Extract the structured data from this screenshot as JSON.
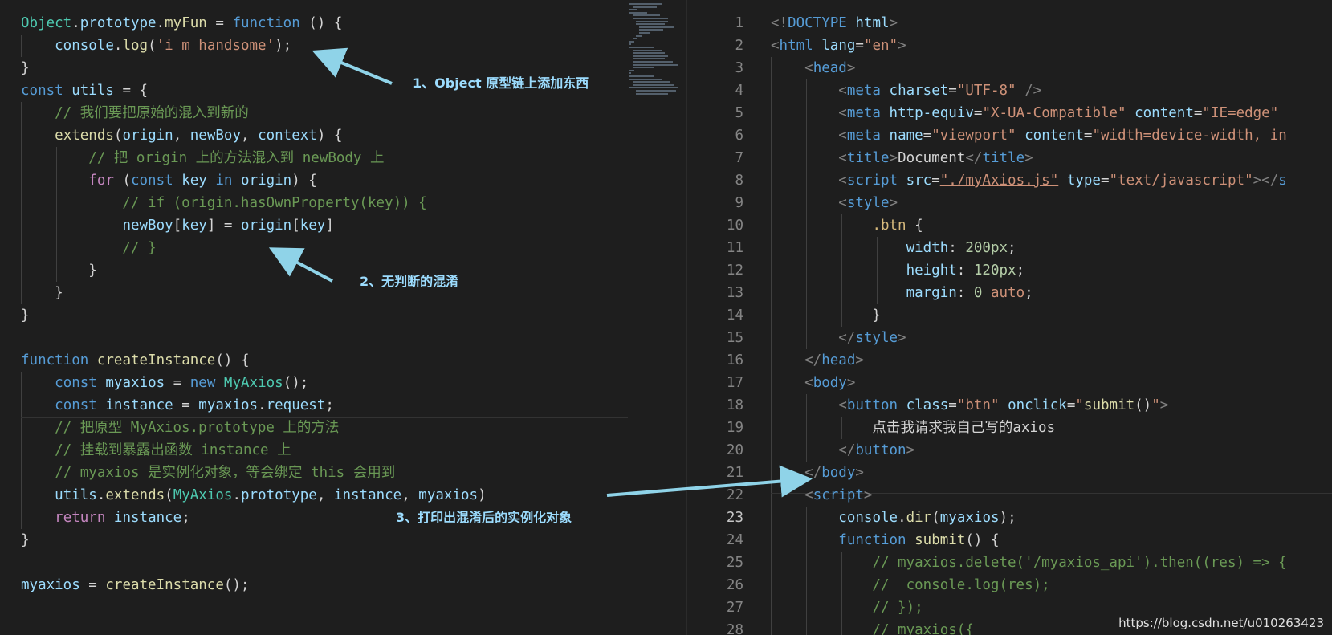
{
  "left_code": [
    [
      [
        "Object",
        "cls"
      ],
      [
        ".",
        "pun"
      ],
      [
        "prototype",
        "prop"
      ],
      [
        ".",
        "pun"
      ],
      [
        "myFun",
        "fn"
      ],
      [
        " = ",
        "pun"
      ],
      [
        "function",
        "kw"
      ],
      [
        " () {",
        "pun"
      ]
    ],
    [
      [
        "    console",
        "var"
      ],
      [
        ".",
        "pun"
      ],
      [
        "log",
        "fn"
      ],
      [
        "(",
        "pun"
      ],
      [
        "'i m handsome'",
        "str"
      ],
      [
        ");",
        "pun"
      ]
    ],
    [
      [
        "}",
        "pun"
      ]
    ],
    [
      [
        "const",
        "kw"
      ],
      [
        " ",
        "pun"
      ],
      [
        "utils",
        "var"
      ],
      [
        " = {",
        "pun"
      ]
    ],
    [
      [
        "    // 我们要把原始的混入到新的",
        "com"
      ]
    ],
    [
      [
        "    ",
        "pun"
      ],
      [
        "extends",
        "fn"
      ],
      [
        "(",
        "pun"
      ],
      [
        "origin",
        "var"
      ],
      [
        ", ",
        "pun"
      ],
      [
        "newBoy",
        "var"
      ],
      [
        ", ",
        "pun"
      ],
      [
        "context",
        "var"
      ],
      [
        ") {",
        "pun"
      ]
    ],
    [
      [
        "        // 把 origin 上的方法混入到 newBody 上",
        "com"
      ]
    ],
    [
      [
        "        ",
        "pun"
      ],
      [
        "for",
        "ctrl"
      ],
      [
        " (",
        "pun"
      ],
      [
        "const",
        "kw"
      ],
      [
        " ",
        "pun"
      ],
      [
        "key",
        "var"
      ],
      [
        " ",
        "pun"
      ],
      [
        "in",
        "kw"
      ],
      [
        " ",
        "pun"
      ],
      [
        "origin",
        "var"
      ],
      [
        ") {",
        "pun"
      ]
    ],
    [
      [
        "            // if (origin.hasOwnProperty(key)) {",
        "com"
      ]
    ],
    [
      [
        "            ",
        "pun"
      ],
      [
        "newBoy",
        "var"
      ],
      [
        "[",
        "pun"
      ],
      [
        "key",
        "var"
      ],
      [
        "] = ",
        "pun"
      ],
      [
        "origin",
        "var"
      ],
      [
        "[",
        "pun"
      ],
      [
        "key",
        "var"
      ],
      [
        "]",
        "pun"
      ]
    ],
    [
      [
        "            // }",
        "com"
      ]
    ],
    [
      [
        "        }",
        "pun"
      ]
    ],
    [
      [
        "    }",
        "pun"
      ]
    ],
    [
      [
        "}",
        "pun"
      ]
    ],
    [
      [
        "",
        "pun"
      ]
    ],
    [
      [
        "function",
        "kw"
      ],
      [
        " ",
        "pun"
      ],
      [
        "createInstance",
        "fn"
      ],
      [
        "() {",
        "pun"
      ]
    ],
    [
      [
        "    ",
        "pun"
      ],
      [
        "const",
        "kw"
      ],
      [
        " ",
        "pun"
      ],
      [
        "myaxios",
        "var"
      ],
      [
        " = ",
        "pun"
      ],
      [
        "new",
        "kw"
      ],
      [
        " ",
        "pun"
      ],
      [
        "MyAxios",
        "cls"
      ],
      [
        "();",
        "pun"
      ]
    ],
    [
      [
        "    ",
        "pun"
      ],
      [
        "const",
        "kw"
      ],
      [
        " ",
        "pun"
      ],
      [
        "instance",
        "var"
      ],
      [
        " = ",
        "pun"
      ],
      [
        "myaxios",
        "var"
      ],
      [
        ".",
        "pun"
      ],
      [
        "request",
        "prop"
      ],
      [
        ";",
        "pun"
      ]
    ],
    [
      [
        "    // 把原型 MyAxios.prototype 上的方法",
        "com"
      ]
    ],
    [
      [
        "    // 挂载到暴露出函数 instance 上",
        "com"
      ]
    ],
    [
      [
        "    // myaxios 是实例化对象，等会绑定 this 会用到",
        "com"
      ]
    ],
    [
      [
        "    ",
        "pun"
      ],
      [
        "utils",
        "var"
      ],
      [
        ".",
        "pun"
      ],
      [
        "extends",
        "fn"
      ],
      [
        "(",
        "pun"
      ],
      [
        "MyAxios",
        "cls"
      ],
      [
        ".",
        "pun"
      ],
      [
        "prototype",
        "prop"
      ],
      [
        ", ",
        "pun"
      ],
      [
        "instance",
        "var"
      ],
      [
        ", ",
        "pun"
      ],
      [
        "myaxios",
        "var"
      ],
      [
        ")",
        "pun"
      ]
    ],
    [
      [
        "    ",
        "pun"
      ],
      [
        "return",
        "ctrl"
      ],
      [
        " ",
        "pun"
      ],
      [
        "instance",
        "var"
      ],
      [
        ";",
        "pun"
      ]
    ],
    [
      [
        "}",
        "pun"
      ]
    ],
    [
      [
        "",
        "pun"
      ]
    ],
    [
      [
        "myaxios",
        "var"
      ],
      [
        " = ",
        "pun"
      ],
      [
        "createInstance",
        "fn"
      ],
      [
        "();",
        "pun"
      ]
    ]
  ],
  "right_code": [
    [
      [
        "<!",
        "brk"
      ],
      [
        "DOCTYPE",
        "tag"
      ],
      [
        " ",
        "pun"
      ],
      [
        "html",
        "attr"
      ],
      [
        ">",
        "brk"
      ]
    ],
    [
      [
        "<",
        "brk"
      ],
      [
        "html",
        "tag"
      ],
      [
        " ",
        "pun"
      ],
      [
        "lang",
        "attr"
      ],
      [
        "=",
        "pun"
      ],
      [
        "\"en\"",
        "str"
      ],
      [
        ">",
        "brk"
      ]
    ],
    [
      [
        "    <",
        "brk"
      ],
      [
        "head",
        "tag"
      ],
      [
        ">",
        "brk"
      ]
    ],
    [
      [
        "        <",
        "brk"
      ],
      [
        "meta",
        "tag"
      ],
      [
        " ",
        "pun"
      ],
      [
        "charset",
        "attr"
      ],
      [
        "=",
        "pun"
      ],
      [
        "\"UTF-8\"",
        "str"
      ],
      [
        " />",
        "brk"
      ]
    ],
    [
      [
        "        <",
        "brk"
      ],
      [
        "meta",
        "tag"
      ],
      [
        " ",
        "pun"
      ],
      [
        "http-equiv",
        "attr"
      ],
      [
        "=",
        "pun"
      ],
      [
        "\"X-UA-Compatible\"",
        "str"
      ],
      [
        " ",
        "pun"
      ],
      [
        "content",
        "attr"
      ],
      [
        "=",
        "pun"
      ],
      [
        "\"IE=edge\"",
        "str"
      ],
      [
        " ",
        "pun"
      ]
    ],
    [
      [
        "        <",
        "brk"
      ],
      [
        "meta",
        "tag"
      ],
      [
        " ",
        "pun"
      ],
      [
        "name",
        "attr"
      ],
      [
        "=",
        "pun"
      ],
      [
        "\"viewport\"",
        "str"
      ],
      [
        " ",
        "pun"
      ],
      [
        "content",
        "attr"
      ],
      [
        "=",
        "pun"
      ],
      [
        "\"width=device-width, in",
        "str"
      ]
    ],
    [
      [
        "        <",
        "brk"
      ],
      [
        "title",
        "tag"
      ],
      [
        ">",
        "brk"
      ],
      [
        "Document",
        "txt"
      ],
      [
        "</",
        "brk"
      ],
      [
        "title",
        "tag"
      ],
      [
        ">",
        "brk"
      ]
    ],
    [
      [
        "        <",
        "brk"
      ],
      [
        "script",
        "tag"
      ],
      [
        " ",
        "pun"
      ],
      [
        "src",
        "attr"
      ],
      [
        "=",
        "pun"
      ],
      [
        "\"./myAxios.js\"",
        "str link"
      ],
      [
        " ",
        "pun"
      ],
      [
        "type",
        "attr"
      ],
      [
        "=",
        "pun"
      ],
      [
        "\"text/javascript\"",
        "str"
      ],
      [
        "></",
        "brk"
      ],
      [
        "s",
        "tag"
      ]
    ],
    [
      [
        "        <",
        "brk"
      ],
      [
        "style",
        "tag"
      ],
      [
        ">",
        "brk"
      ]
    ],
    [
      [
        "            ",
        "pun"
      ],
      [
        ".btn",
        "csssel"
      ],
      [
        " {",
        "pun"
      ]
    ],
    [
      [
        "                ",
        "pun"
      ],
      [
        "width",
        "cssprop"
      ],
      [
        ": ",
        "pun"
      ],
      [
        "200px",
        "num"
      ],
      [
        ";",
        "pun"
      ]
    ],
    [
      [
        "                ",
        "pun"
      ],
      [
        "height",
        "cssprop"
      ],
      [
        ": ",
        "pun"
      ],
      [
        "120px",
        "num"
      ],
      [
        ";",
        "pun"
      ]
    ],
    [
      [
        "                ",
        "pun"
      ],
      [
        "margin",
        "cssprop"
      ],
      [
        ": ",
        "pun"
      ],
      [
        "0",
        "num"
      ],
      [
        " ",
        "pun"
      ],
      [
        "auto",
        "cssval"
      ],
      [
        ";",
        "pun"
      ]
    ],
    [
      [
        "            }",
        "pun"
      ]
    ],
    [
      [
        "        </",
        "brk"
      ],
      [
        "style",
        "tag"
      ],
      [
        ">",
        "brk"
      ]
    ],
    [
      [
        "    </",
        "brk"
      ],
      [
        "head",
        "tag"
      ],
      [
        ">",
        "brk"
      ]
    ],
    [
      [
        "    <",
        "brk"
      ],
      [
        "body",
        "tag"
      ],
      [
        ">",
        "brk"
      ]
    ],
    [
      [
        "        <",
        "brk"
      ],
      [
        "button",
        "tag"
      ],
      [
        " ",
        "pun"
      ],
      [
        "class",
        "attr"
      ],
      [
        "=",
        "pun"
      ],
      [
        "\"btn\"",
        "str"
      ],
      [
        " ",
        "pun"
      ],
      [
        "onclick",
        "attr"
      ],
      [
        "=",
        "pun"
      ],
      [
        "\"",
        "str"
      ],
      [
        "submit",
        "fn"
      ],
      [
        "()",
        "pun"
      ],
      [
        "\"",
        "str"
      ],
      [
        ">",
        "brk"
      ]
    ],
    [
      [
        "            点击我请求我自己写的axios",
        "txt"
      ]
    ],
    [
      [
        "        </",
        "brk"
      ],
      [
        "button",
        "tag"
      ],
      [
        ">",
        "brk"
      ]
    ],
    [
      [
        "    </",
        "brk"
      ],
      [
        "body",
        "tag"
      ],
      [
        ">",
        "brk"
      ]
    ],
    [
      [
        "    <",
        "brk"
      ],
      [
        "script",
        "tag"
      ],
      [
        ">",
        "brk"
      ]
    ],
    [
      [
        "        ",
        "pun"
      ],
      [
        "console",
        "var"
      ],
      [
        ".",
        "pun"
      ],
      [
        "dir",
        "fn"
      ],
      [
        "(",
        "pun"
      ],
      [
        "myaxios",
        "var"
      ],
      [
        ");",
        "pun"
      ]
    ],
    [
      [
        "        ",
        "pun"
      ],
      [
        "function",
        "kw"
      ],
      [
        " ",
        "pun"
      ],
      [
        "submit",
        "fn"
      ],
      [
        "() {",
        "pun"
      ]
    ],
    [
      [
        "            // myaxios.delete('/myaxios_api').then((res) => {",
        "com"
      ]
    ],
    [
      [
        "            //  console.log(res);",
        "com"
      ]
    ],
    [
      [
        "            // });",
        "com"
      ]
    ],
    [
      [
        "            // myaxios({",
        "com"
      ]
    ]
  ],
  "right_line_numbers": [
    "1",
    "2",
    "3",
    "4",
    "5",
    "6",
    "7",
    "8",
    "9",
    "10",
    "11",
    "12",
    "13",
    "14",
    "15",
    "16",
    "17",
    "18",
    "19",
    "20",
    "21",
    "22",
    "23",
    "24",
    "25",
    "26",
    "27",
    "28"
  ],
  "active_line": "23",
  "annotations": {
    "a1": "1、Object 原型链上添加东西",
    "a2": "2、无判断的混淆",
    "a3": "3、打印出混淆后的实例化对象"
  },
  "watermark": "https://blog.csdn.net/u010263423",
  "colors": {
    "background": "#1e1e1e",
    "arrow": "#8fd3e8",
    "annotation": "#9cdcfe"
  }
}
